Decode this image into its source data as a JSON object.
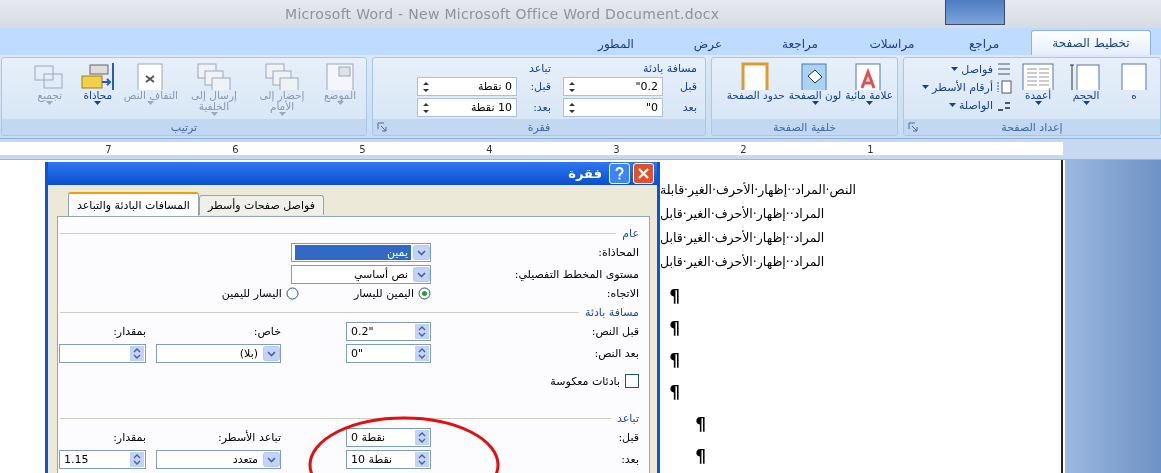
{
  "window": {
    "title": "Microsoft Word - New Microsoft Office Word Document.docx"
  },
  "tabs": [
    {
      "label": "تخطيط الصفحة",
      "selected": true
    },
    {
      "label": "مراجع",
      "selected": false
    },
    {
      "label": "مراسلات",
      "selected": false
    },
    {
      "label": "مراجعة",
      "selected": false
    },
    {
      "label": "عرض",
      "selected": false
    },
    {
      "label": "المطور",
      "selected": false
    }
  ],
  "ribbon": {
    "groups": [
      {
        "kind": "buttons",
        "title": "إعداد الصفحة",
        "launcher": true,
        "buttons": [
          {
            "label": "ه",
            "kind": "page",
            "dropdown": false,
            "disabled": false
          },
          {
            "label": "الحجم",
            "kind": "size",
            "dropdown": true,
            "disabled": false
          },
          {
            "label": "أعمدة",
            "kind": "columns",
            "dropdown": true,
            "disabled": false
          }
        ],
        "small": [
          {
            "label": "فواصل",
            "kind": "breaks"
          },
          {
            "label": "أرقام الأسطر",
            "kind": "numbers"
          },
          {
            "label": "الواصلة",
            "kind": "hyphenation"
          }
        ]
      },
      {
        "kind": "buttons",
        "title": "خلفية الصفحة",
        "launcher": false,
        "buttons": [
          {
            "label": "علامة مائية",
            "kind": "watermark",
            "dropdown": true,
            "disabled": false
          },
          {
            "label": "لون الصفحة",
            "kind": "color",
            "dropdown": true,
            "disabled": false
          },
          {
            "label": "حدود الصفحة",
            "kind": "borders",
            "dropdown": false,
            "disabled": false
          }
        ]
      },
      {
        "kind": "fields",
        "title": "فقرة",
        "launcher": true,
        "sections": [
          {
            "title": "مسافة بادئة",
            "rows": [
              {
                "label": "قبل",
                "value": "0.2\""
              },
              {
                "label": "بعد",
                "value": "0\""
              }
            ]
          },
          {
            "title": "تباعد",
            "rows": [
              {
                "label": "قبل:",
                "value": "0 نقطة"
              },
              {
                "label": "بعد:",
                "value": "10 نقطة"
              }
            ]
          }
        ]
      },
      {
        "kind": "buttons",
        "title": "ترتيب",
        "launcher": false,
        "buttons": [
          {
            "label": "الموضع",
            "kind": "position",
            "dropdown": true,
            "disabled": true
          },
          {
            "label": "إحضار إلى الأمام",
            "kind": "stack",
            "dropdown": true,
            "disabled": true
          },
          {
            "label": "إرسال إلى الخلفية",
            "kind": "stack",
            "dropdown": true,
            "disabled": true
          },
          {
            "label": "التفاف النص",
            "kind": "wrap",
            "dropdown": true,
            "disabled": true
          },
          {
            "label": "محاذاة",
            "kind": "align",
            "dropdown": true,
            "disabled": false
          },
          {
            "label": "تجميع",
            "kind": "group",
            "dropdown": true,
            "disabled": true
          }
        ]
      }
    ]
  },
  "ruler": {
    "numbers": [
      "1",
      "2",
      "3",
      "4",
      "5",
      "6",
      "7"
    ]
  },
  "dialog": {
    "title": "فقرة",
    "tabs": [
      {
        "label": "فواصل صفحات وأسطر",
        "selected": false
      },
      {
        "label": "المسافات البادئة والتباعد",
        "selected": true
      }
    ],
    "general": {
      "title": "عام",
      "alignment": {
        "label": "المحاذاة:",
        "value": "يمين"
      },
      "outline": {
        "label": "مستوى المخطط التفصيلي:",
        "value": "نص أساسي"
      },
      "direction": {
        "label": "الاتجاه:",
        "options": [
          {
            "label": "اليمين لليسار",
            "selected": true
          },
          {
            "label": "اليسار لليمين",
            "selected": false
          }
        ]
      }
    },
    "indent": {
      "title": "مسافة بادئة",
      "before": {
        "label": "قبل النص:",
        "value": "0.2\""
      },
      "after": {
        "label": "بعد النص:",
        "value": "0\""
      },
      "special": {
        "label": "خاص:",
        "value": "(بلا)"
      },
      "by": {
        "label": "بمقدار:"
      },
      "mirror": {
        "label": "بادئات معكوسة",
        "checked": false
      }
    },
    "spacing": {
      "title": "تباعد",
      "before": {
        "label": "قبل:",
        "value": "0 نقطة"
      },
      "after": {
        "label": "بعد:",
        "value": "10 نقطة"
      },
      "line": {
        "label": "تباعد الأسطر:",
        "value": "متعدد"
      },
      "at": {
        "label": "بمقدار:",
        "value": "1.15"
      }
    }
  },
  "document": {
    "lines": [
      "النص·المراد··إظهار·الأحرف·الغير·قابلة",
      "المراد··إظهار·الأحرف·الغير·قابل",
      "المراد··إظهار·الأحرف·الغير·قابل",
      "المراد··إظهار·الأحرف·الغير·قابل"
    ],
    "marks": [
      {
        "text": "¶",
        "kind": "body"
      },
      {
        "text": "¶",
        "kind": "body"
      },
      {
        "text": "¶",
        "kind": "body"
      },
      {
        "text": "¶",
        "kind": "body"
      },
      {
        "text": "¶",
        "kind": "shifted"
      },
      {
        "text": "¶",
        "kind": "shifted"
      }
    ]
  }
}
